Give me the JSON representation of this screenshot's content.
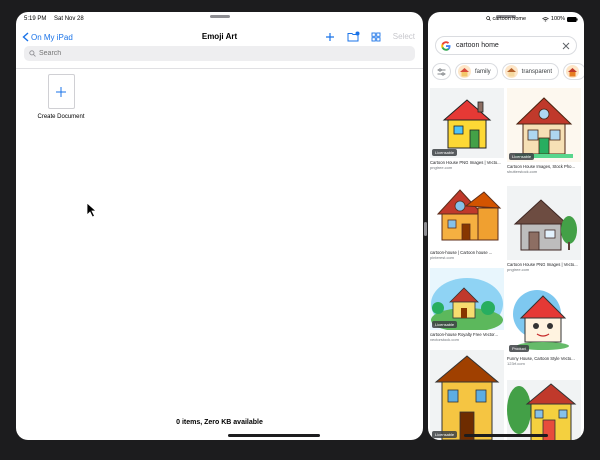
{
  "left_pane": {
    "status": {
      "time": "5:19 PM",
      "date": "Sat Nov 28"
    },
    "nav": {
      "back_label": "On My iPad",
      "title": "Emoji Art",
      "select_label": "Select"
    },
    "search": {
      "placeholder": "Search"
    },
    "create_document_label": "Create Document",
    "footer_info": "0 items, Zero KB available",
    "accent_color": "#1a73e8"
  },
  "right_pane": {
    "status": {
      "url": "cartoon home",
      "battery": "100%"
    },
    "search": {
      "query": "cartoon home"
    },
    "chips": [
      {
        "label": "family"
      },
      {
        "label": "transparent"
      }
    ],
    "results": [
      {
        "title": "Cartoon House PNG Images | Vecto...",
        "source": "pngtree.com",
        "badge": "Licensable"
      },
      {
        "title": "Cartoon House Images, Stock Pho...",
        "source": "shutterstock.com",
        "badge": "Licensable"
      },
      {
        "title": "cartoon-house | Cartoon house ...",
        "source": "pinterest.com",
        "badge": ""
      },
      {
        "title": "Cartoon House PNG Images | Vecto...",
        "source": "pngtree.com",
        "badge": ""
      },
      {
        "title": "cartoon-house Royalty Free Vector...",
        "source": "vectorstock.com",
        "badge": "Licensable"
      },
      {
        "title": "Funny House, Cartoon Style Vecto...",
        "source": "123rf.com",
        "badge": "Product"
      },
      {
        "title": "",
        "source": "",
        "badge": "Licensable"
      },
      {
        "title": "",
        "source": "",
        "badge": ""
      }
    ]
  }
}
